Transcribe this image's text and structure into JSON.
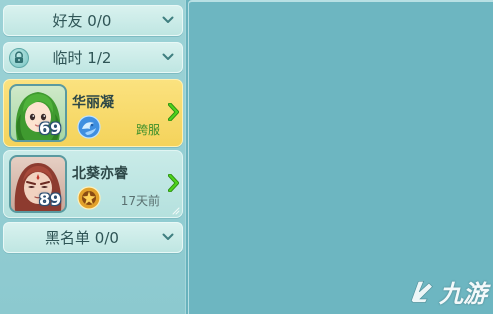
{
  "groups": {
    "friends": {
      "label": "好友 0/0"
    },
    "temporary": {
      "label": "临时 1/2"
    },
    "blacklist": {
      "label": "黑名单 0/0"
    }
  },
  "friends": [
    {
      "name": "华丽凝",
      "level": "69",
      "status": "跨服",
      "selected": true
    },
    {
      "name": "北葵亦睿",
      "level": "89",
      "status": "17天前",
      "selected": false
    }
  ],
  "watermark": {
    "text": "九游"
  },
  "colors": {
    "background": "#68b2bd",
    "selected_card": "#f4d35b",
    "normal_card": "#c9ebe8",
    "cross_server_text": "#3a8e2a",
    "arrow_green": "#3fbf1a"
  }
}
